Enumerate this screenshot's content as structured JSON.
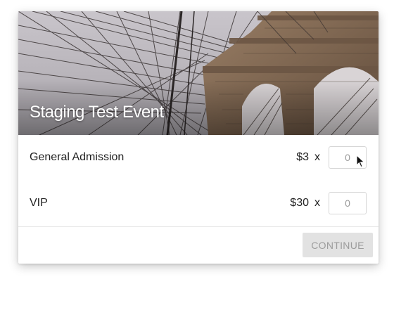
{
  "event": {
    "title": "Staging Test Event"
  },
  "tickets": [
    {
      "name": "General Admission",
      "price": "$3",
      "multiplier": "x",
      "quantity_placeholder": "0"
    },
    {
      "name": "VIP",
      "price": "$30",
      "multiplier": "x",
      "quantity_placeholder": "0"
    }
  ],
  "actions": {
    "continue_label": "CONTINUE"
  },
  "colors": {
    "button_background": "#e2e2e2",
    "button_text": "#9c9c9c",
    "title_text": "#ffffff"
  }
}
